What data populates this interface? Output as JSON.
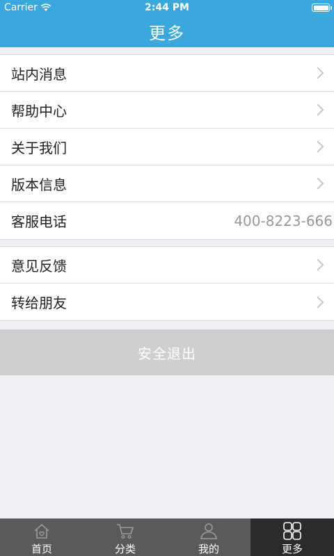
{
  "status_bar": {
    "carrier": "Carrier",
    "time": "2:44 PM",
    "battery_level": 1.0
  },
  "header": {
    "title": "更多"
  },
  "group1": [
    {
      "label": "站内消息",
      "chevron": true
    },
    {
      "label": "帮助中心",
      "chevron": true
    },
    {
      "label": "关于我们",
      "chevron": true
    },
    {
      "label": "版本信息",
      "chevron": true
    },
    {
      "label": "客服电话",
      "value": "400-8223-666"
    }
  ],
  "group2": [
    {
      "label": "意见反馈",
      "chevron": true
    },
    {
      "label": "转给朋友",
      "chevron": true
    }
  ],
  "logout": {
    "label": "安全退出"
  },
  "tabbar": {
    "tabs": [
      {
        "label": "首页",
        "icon": "home-icon"
      },
      {
        "label": "分类",
        "icon": "cart-icon"
      },
      {
        "label": "我的",
        "icon": "person-icon"
      },
      {
        "label": "更多",
        "icon": "grid-icon",
        "active": true
      }
    ]
  },
  "colors": {
    "header": "#3aa8dd",
    "background": "#efeff4",
    "logout": "#cfcfcf",
    "tabbar": "#5a5a5a",
    "tab_active": "#2b2b2b"
  }
}
